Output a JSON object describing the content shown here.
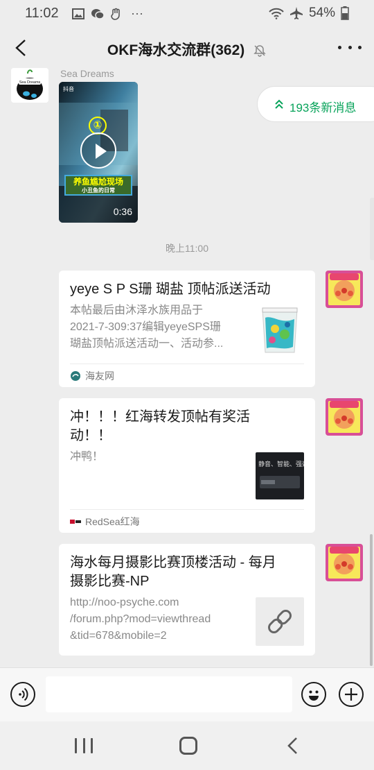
{
  "status_bar": {
    "time": "11:02",
    "battery": "54%",
    "more": "···"
  },
  "header": {
    "title": "OKF海水交流群(362)"
  },
  "messages": {
    "first_sender": "Sea Dreams",
    "avatar_text": "Sea Dreams",
    "video": {
      "platform": "抖音",
      "number": "①",
      "caption_line1": "养鱼尴尬现场",
      "caption_line2": "小丑鱼的日常",
      "duration": "0:36"
    },
    "new_messages_label": "193条新消息",
    "time_separator": "晚上11:00",
    "cards": [
      {
        "title": "yeye S P S珊 瑚盐 顶帖派送活动",
        "desc_lines": [
          "本帖最后由沐泽水族用品于",
          "2021-7-309:37编辑yeyeSPS珊",
          "瑚盐顶帖派送活动一、活动参..."
        ],
        "source": "海友网"
      },
      {
        "title_lines": [
          "冲！！！红海转发顶帖有奖活",
          "动！！"
        ],
        "desc": "冲鸭！",
        "thumb_text": "静音、智能、强劲",
        "source": "RedSea红海"
      },
      {
        "title_lines": [
          "海水每月摄影比赛顶楼活动 - 每月",
          "摄影比赛-NP"
        ],
        "desc_lines": [
          "http://noo-psyche.com",
          "/forum.php?mod=viewthread",
          "&tid=678&mobile=2"
        ]
      }
    ]
  },
  "input": {
    "placeholder": ""
  }
}
